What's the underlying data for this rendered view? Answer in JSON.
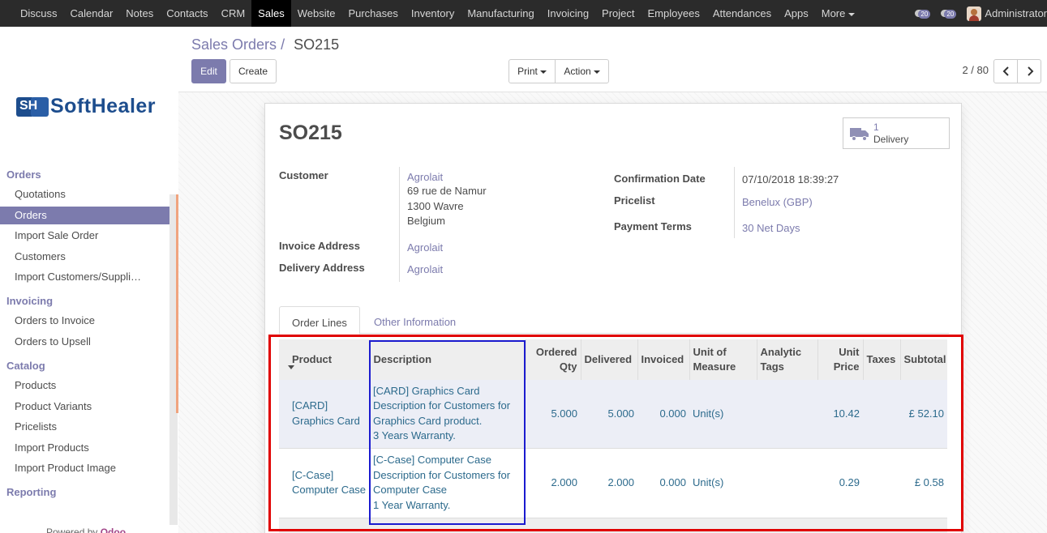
{
  "topnav": {
    "items": [
      "Discuss",
      "Calendar",
      "Notes",
      "Contacts",
      "CRM",
      "Sales",
      "Website",
      "Purchases",
      "Inventory",
      "Manufacturing",
      "Invoicing",
      "Project",
      "Employees",
      "Attendances",
      "Apps",
      "More"
    ],
    "active": "Sales",
    "activity_count": "20",
    "message_count": "20",
    "user": "Administrator"
  },
  "sidebar": {
    "logo_text": "SoftHealer",
    "logo_mark": "SH",
    "sections": [
      {
        "title": "Orders",
        "items": [
          "Quotations",
          "Orders",
          "Import Sale Order",
          "Customers",
          "Import Customers/Suppli…"
        ]
      },
      {
        "title": "Invoicing",
        "items": [
          "Orders to Invoice",
          "Orders to Upsell"
        ]
      },
      {
        "title": "Catalog",
        "items": [
          "Products",
          "Product Variants",
          "Pricelists",
          "Import Products",
          "Import Product Image"
        ]
      },
      {
        "title": "Reporting",
        "items": []
      }
    ],
    "active_item": "Orders",
    "powered_prefix": "Powered by",
    "powered_brand": "Odoo"
  },
  "control_panel": {
    "breadcrumb_parent": "Sales Orders",
    "breadcrumb_sep": "/",
    "breadcrumb_current": "SO215",
    "edit_label": "Edit",
    "create_label": "Create",
    "print_label": "Print",
    "action_label": "Action",
    "pager": "2 / 80"
  },
  "form": {
    "title": "SO215",
    "smart_button": {
      "count": "1",
      "label": "Delivery",
      "icon": "truck-icon"
    },
    "customer_label": "Customer",
    "customer_name": "Agrolait",
    "customer_address": [
      "69 rue de Namur",
      "1300 Wavre",
      "Belgium"
    ],
    "invoice_address_label": "Invoice Address",
    "invoice_address": "Agrolait",
    "delivery_address_label": "Delivery Address",
    "delivery_address": "Agrolait",
    "confirmation_date_label": "Confirmation Date",
    "confirmation_date": "07/10/2018 18:39:27",
    "pricelist_label": "Pricelist",
    "pricelist": "Benelux (GBP)",
    "payment_terms_label": "Payment Terms",
    "payment_terms": "30 Net Days",
    "tabs": [
      "Order Lines",
      "Other Information"
    ],
    "active_tab": "Order Lines"
  },
  "order_lines": {
    "columns": [
      {
        "key": "product",
        "label": "Product"
      },
      {
        "key": "description",
        "label": "Description"
      },
      {
        "key": "ordered_qty",
        "label": "Ordered Qty"
      },
      {
        "key": "delivered",
        "label": "Delivered"
      },
      {
        "key": "invoiced",
        "label": "Invoiced"
      },
      {
        "key": "uom",
        "label": "Unit of Measure"
      },
      {
        "key": "analytic_tags",
        "label": "Analytic Tags"
      },
      {
        "key": "unit_price",
        "label": "Unit Price"
      },
      {
        "key": "taxes",
        "label": "Taxes"
      },
      {
        "key": "subtotal",
        "label": "Subtotal"
      }
    ],
    "rows": [
      {
        "product": [
          "[CARD]",
          "Graphics Card"
        ],
        "description": [
          "[CARD] Graphics Card",
          "Description for Customers for",
          "Graphics Card product.",
          "3 Years Warranty."
        ],
        "ordered_qty": "5.000",
        "delivered": "5.000",
        "invoiced": "0.000",
        "uom": "Unit(s)",
        "analytic_tags": "",
        "unit_price": "10.42",
        "taxes": "",
        "subtotal": "£ 52.10"
      },
      {
        "product": [
          "[C-Case]",
          "Computer Case"
        ],
        "description": [
          "[C-Case] Computer Case",
          "Description for Customers for",
          "Computer Case",
          "1 Year Warranty."
        ],
        "ordered_qty": "2.000",
        "delivered": "2.000",
        "invoiced": "0.000",
        "uom": "Unit(s)",
        "analytic_tags": "",
        "unit_price": "0.29",
        "taxes": "",
        "subtotal": "£ 0.58"
      }
    ]
  },
  "highlight_colors": {
    "outer": "#e00000",
    "description": "#1b1bcf"
  }
}
